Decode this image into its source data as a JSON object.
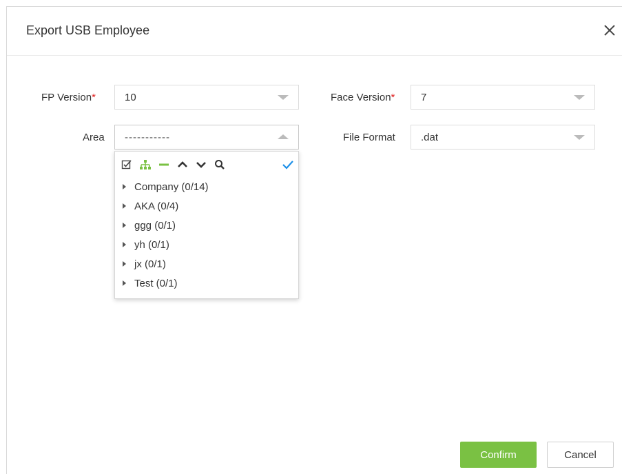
{
  "dialog": {
    "title": "Export USB Employee",
    "close_icon": "close-icon"
  },
  "fields": {
    "fp_version": {
      "label": "FP Version",
      "required_mark": "*",
      "value": "10"
    },
    "face_version": {
      "label": "Face Version",
      "required_mark": "*",
      "value": "7"
    },
    "area": {
      "label": "Area",
      "value": "-----------",
      "expanded": true
    },
    "file_format": {
      "label": "File Format",
      "value": ".dat"
    }
  },
  "tree_toolbar": {
    "icons": [
      "select-all-icon",
      "org-tree-icon",
      "collapse-icon",
      "expand-up-icon",
      "expand-down-icon",
      "search-icon"
    ],
    "confirm_icon": "checkmark-icon"
  },
  "tree_items": [
    {
      "label": "Company (0/14)"
    },
    {
      "label": "AKA (0/4)"
    },
    {
      "label": "ggg (0/1)"
    },
    {
      "label": "yh (0/1)"
    },
    {
      "label": "jx (0/1)"
    },
    {
      "label": "Test (0/1)"
    }
  ],
  "buttons": {
    "confirm": "Confirm",
    "cancel": "Cancel"
  },
  "colors": {
    "accent_green": "#7ac143",
    "required_red": "#e02020",
    "check_blue": "#1e90e8"
  }
}
